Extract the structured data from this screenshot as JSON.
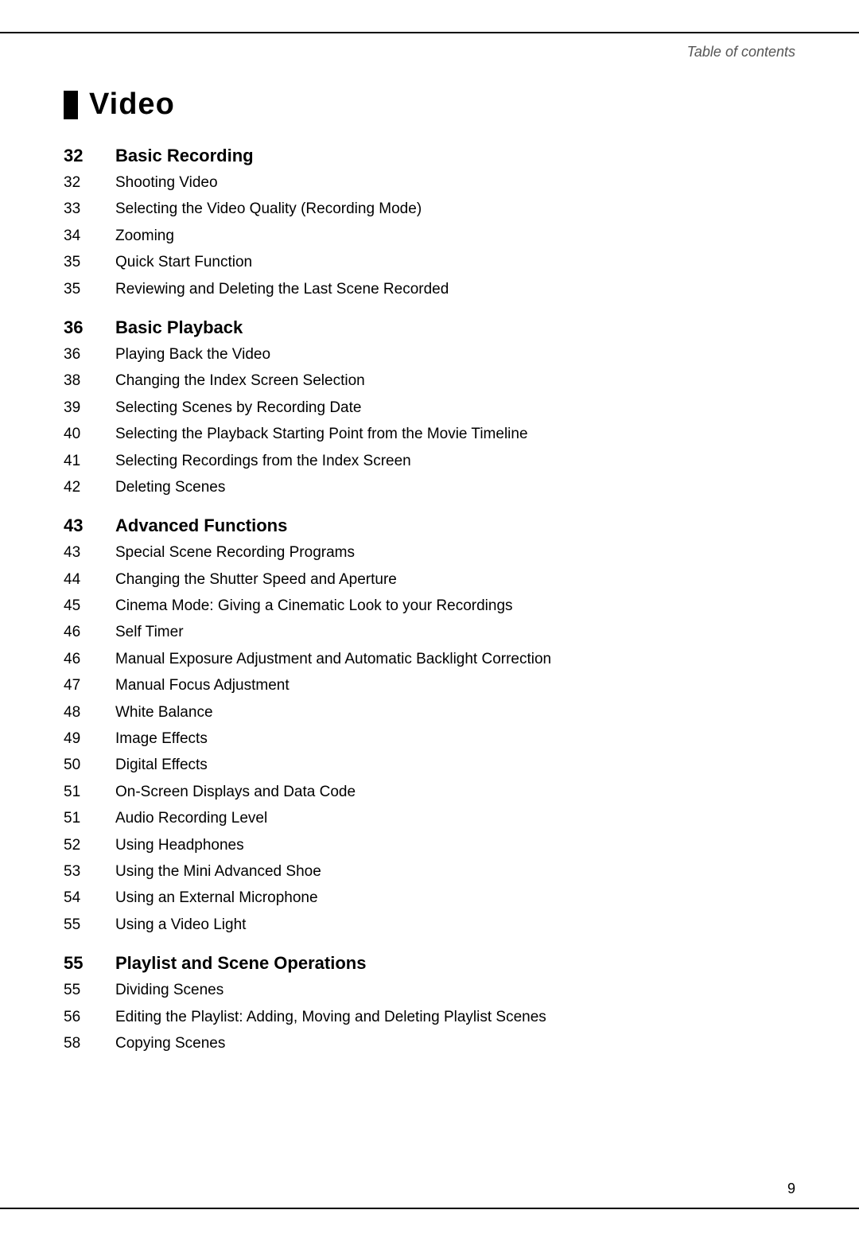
{
  "page": {
    "header_label": "Table of contents",
    "page_number": "9",
    "watermark_text": ""
  },
  "section_title": {
    "marker": "■",
    "text": "Video"
  },
  "sections": [
    {
      "id": "basic-recording",
      "number": "32",
      "label": "Basic Recording",
      "entries": [
        {
          "number": "32",
          "text": "Shooting Video"
        },
        {
          "number": "33",
          "text": "Selecting the Video Quality (Recording Mode)"
        },
        {
          "number": "34",
          "text": "Zooming"
        },
        {
          "number": "35",
          "text": "Quick Start Function"
        },
        {
          "number": "35",
          "text": "Reviewing and Deleting the Last Scene Recorded"
        }
      ]
    },
    {
      "id": "basic-playback",
      "number": "36",
      "label": "Basic Playback",
      "entries": [
        {
          "number": "36",
          "text": "Playing Back the Video"
        },
        {
          "number": "38",
          "text": "Changing the Index Screen Selection"
        },
        {
          "number": "39",
          "text": "Selecting Scenes by Recording Date"
        },
        {
          "number": "40",
          "text": "Selecting the Playback Starting Point from the Movie Timeline"
        },
        {
          "number": "41",
          "text": "Selecting Recordings from the Index Screen"
        },
        {
          "number": "42",
          "text": "Deleting Scenes"
        }
      ]
    },
    {
      "id": "advanced-functions",
      "number": "43",
      "label": "Advanced Functions",
      "entries": [
        {
          "number": "43",
          "text": "Special Scene Recording Programs"
        },
        {
          "number": "44",
          "text": "Changing the Shutter Speed and Aperture"
        },
        {
          "number": "45",
          "text": "Cinema Mode: Giving a Cinematic Look to your Recordings"
        },
        {
          "number": "46",
          "text": "Self Timer"
        },
        {
          "number": "46",
          "text": "Manual Exposure Adjustment and Automatic Backlight Correction"
        },
        {
          "number": "47",
          "text": "Manual Focus Adjustment"
        },
        {
          "number": "48",
          "text": "White Balance"
        },
        {
          "number": "49",
          "text": "Image Effects"
        },
        {
          "number": "50",
          "text": "Digital Effects"
        },
        {
          "number": "51",
          "text": "On-Screen Displays and Data Code"
        },
        {
          "number": "51",
          "text": "Audio Recording Level"
        },
        {
          "number": "52",
          "text": "Using Headphones"
        },
        {
          "number": "53",
          "text": "Using the Mini Advanced Shoe"
        },
        {
          "number": "54",
          "text": "Using an External Microphone"
        },
        {
          "number": "55",
          "text": "Using a Video Light"
        }
      ]
    },
    {
      "id": "playlist-scene-operations",
      "number": "55",
      "label": "Playlist and Scene Operations",
      "entries": [
        {
          "number": "55",
          "text": "Dividing Scenes"
        },
        {
          "number": "56",
          "text": "Editing the Playlist: Adding, Moving and Deleting Playlist Scenes"
        },
        {
          "number": "58",
          "text": "Copying Scenes"
        }
      ]
    }
  ]
}
